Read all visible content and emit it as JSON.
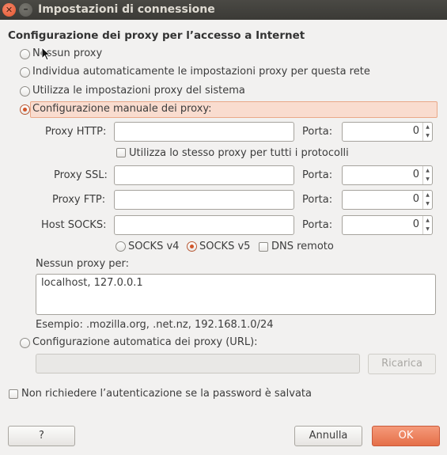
{
  "window": {
    "title": "Impostazioni di connessione",
    "close_glyph": "✕",
    "min_glyph": "–"
  },
  "section_title": "Configurazione dei proxy per l’accesso a Internet",
  "proxy_mode": {
    "no_proxy": "Nessun proxy",
    "auto_detect": "Individua automaticamente le impostazioni proxy per questa rete",
    "system": "Utilizza le impostazioni proxy del sistema",
    "manual": "Configurazione manuale dei proxy:",
    "selected": "manual"
  },
  "manual": {
    "http_label": "Proxy HTTP:",
    "ssl_label": "Proxy SSL:",
    "ftp_label": "Proxy FTP:",
    "socks_label": "Host SOCKS:",
    "port_label": "Porta:",
    "http_host": "",
    "ssl_host": "",
    "ftp_host": "",
    "socks_host": "",
    "http_port": "0",
    "ssl_port": "0",
    "ftp_port": "0",
    "socks_port": "0",
    "same_proxy": "Utilizza lo stesso proxy per tutti i protocolli",
    "socks_v4": "SOCKS v4",
    "socks_v5": "SOCKS v5",
    "dns_remote": "DNS remoto"
  },
  "no_proxy_for": {
    "label": "Nessun proxy per:",
    "value": "localhost, 127.0.0.1",
    "example": "Esempio: .mozilla.org, .net.nz, 192.168.1.0/24"
  },
  "auto_config": {
    "label": "Configurazione automatica dei proxy (URL):",
    "url": "",
    "reload": "Ricarica"
  },
  "no_auth_prompt": "Non richiedere l’autenticazione se la password è salvata",
  "buttons": {
    "help": "?",
    "cancel": "Annulla",
    "ok": "OK"
  },
  "colors": {
    "accent": "#e56f49",
    "highlight": "#f9dccf",
    "titlebar": "#3b3a36"
  }
}
